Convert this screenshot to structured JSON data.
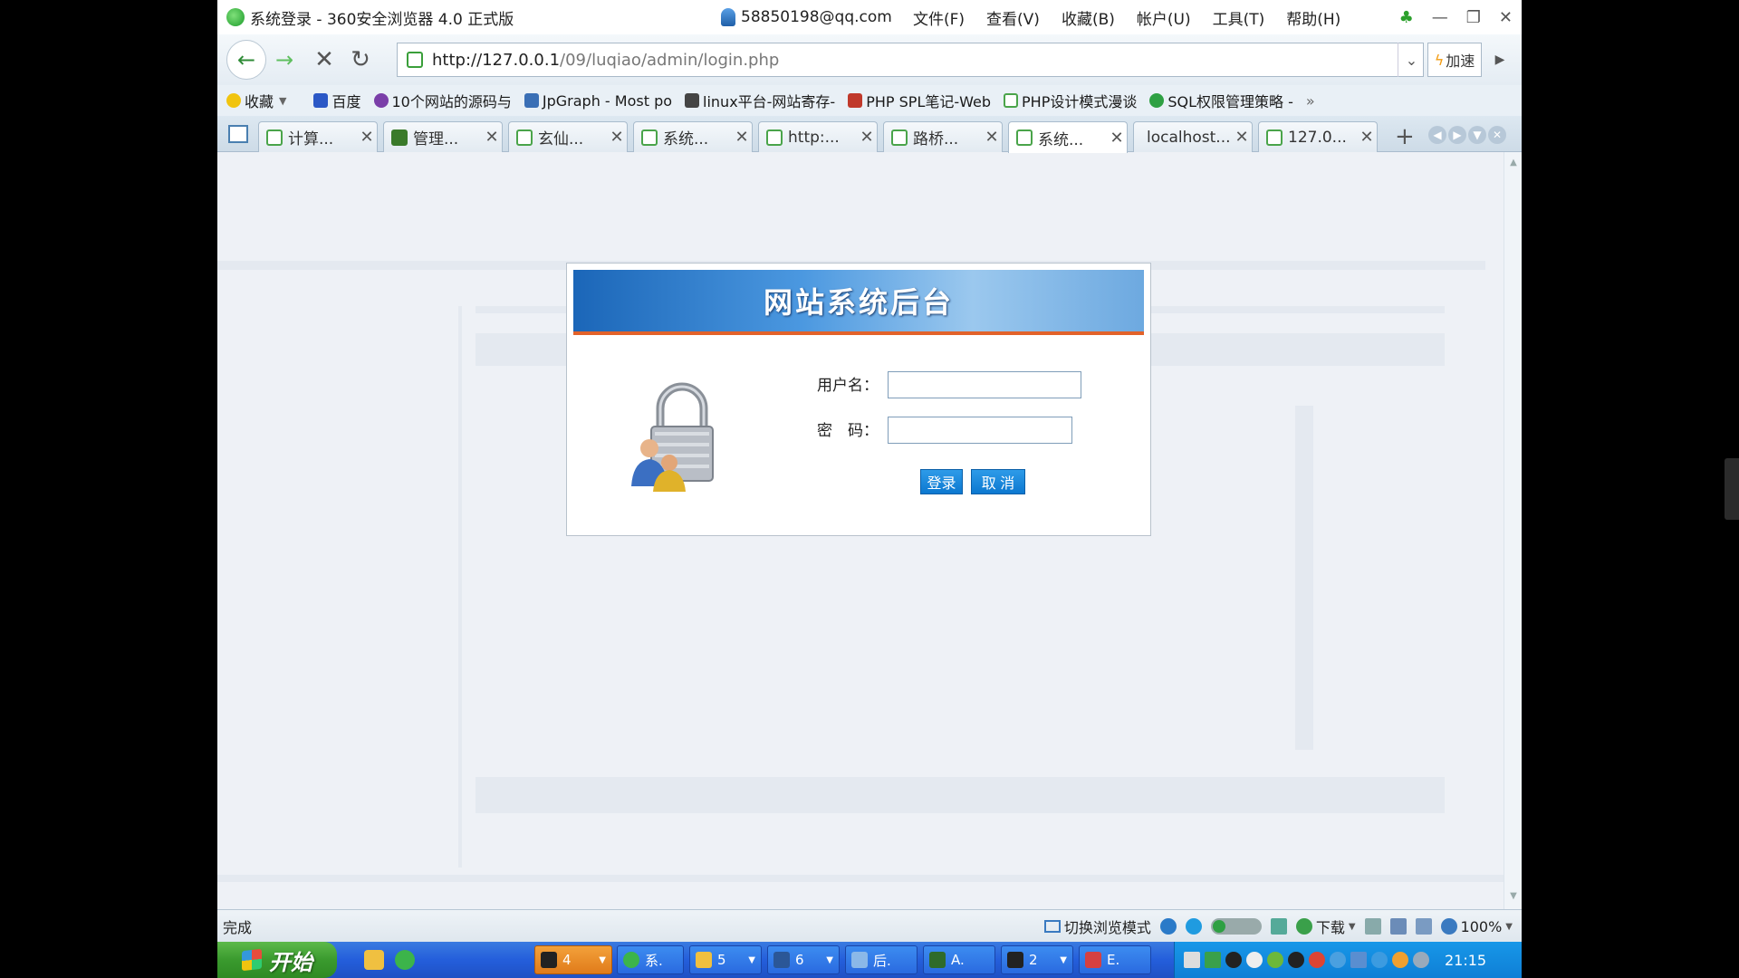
{
  "window": {
    "title": "系统登录 - 360安全浏览器 4.0 正式版",
    "account": "58850198@qq.com",
    "menu": [
      "文件(F)",
      "查看(V)",
      "收藏(B)",
      "帐户(U)",
      "工具(T)",
      "帮助(H)"
    ]
  },
  "nav": {
    "url_host": "http://127.0.0.1",
    "url_path": "/09/luqiao/admin/login.php",
    "speedup_label": "加速"
  },
  "bookmarks": {
    "favorites_label": "收藏",
    "items": [
      "百度",
      "10个网站的源码与",
      "JpGraph - Most po",
      "linux平台-网站寄存-",
      "PHP SPL笔记-Web",
      "PHP设计模式漫谈",
      "SQL权限管理策略 -"
    ],
    "more": "»"
  },
  "tabs": {
    "items": [
      "计算...",
      "管理...",
      "玄仙...",
      "系统...",
      "http:...",
      "路桥...",
      "系统...",
      "localhost...",
      "127.0..."
    ],
    "active_index": 6,
    "close_glyph": "✕",
    "new_tab_glyph": "+"
  },
  "login": {
    "title": "网站系统后台",
    "username_label": "用户名：",
    "password_label": "密　码：",
    "login_button": "登录",
    "cancel_button": "取 消"
  },
  "status": {
    "text": "完成",
    "switch_mode": "切换浏览模式",
    "download": "下载",
    "zoom": "100%"
  },
  "taskbar": {
    "start_label": "开始",
    "items": [
      {
        "label": "4",
        "highlighted": true
      },
      {
        "label": "系.",
        "highlighted": false
      },
      {
        "label": "5",
        "highlighted": false
      },
      {
        "label": "6",
        "highlighted": false
      },
      {
        "label": "后.",
        "highlighted": false
      },
      {
        "label": "A.",
        "highlighted": false
      },
      {
        "label": "2",
        "highlighted": false
      },
      {
        "label": "E.",
        "highlighted": false
      }
    ],
    "clock": "21:15"
  },
  "colors": {
    "header_blue": "#1b66b8",
    "header_accent": "#e2622a",
    "button_blue": "#0c78d0",
    "taskbar_blue": "#245edb",
    "start_green": "#3a9a2e"
  }
}
